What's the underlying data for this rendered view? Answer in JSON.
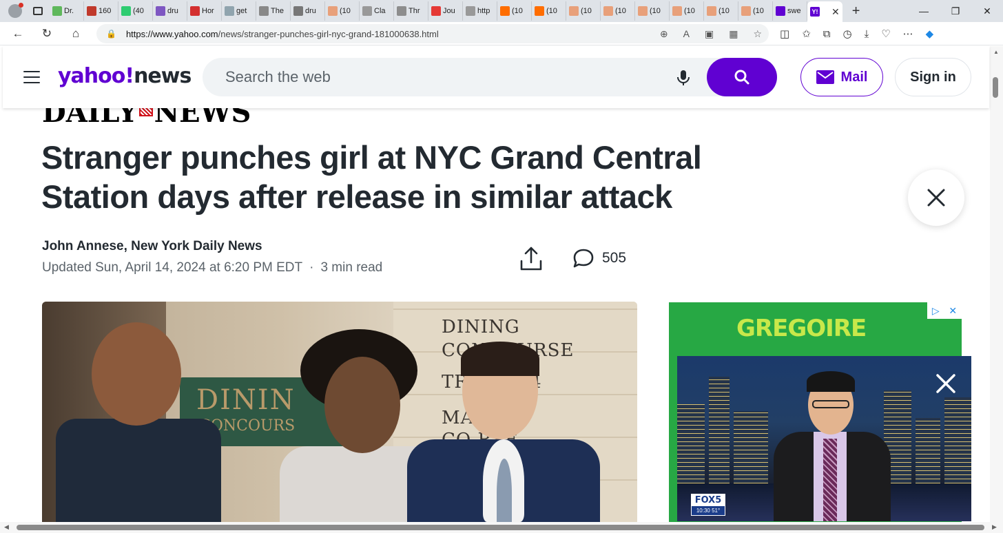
{
  "browser": {
    "tabs": [
      {
        "label": "Dr.",
        "color": "#5fb85c"
      },
      {
        "label": "160",
        "color": "#c0392b"
      },
      {
        "label": "(40",
        "color": "#2ecc71"
      },
      {
        "label": "dru",
        "color": "#7e57c2"
      },
      {
        "label": "Hor",
        "color": "#d32f2f"
      },
      {
        "label": "get",
        "color": "#90a4ae"
      },
      {
        "label": "The",
        "color": "#888888"
      },
      {
        "label": "dru",
        "color": "#777777"
      },
      {
        "label": "(10",
        "color": "#e8a07a"
      },
      {
        "label": "Cla",
        "color": "#999999"
      },
      {
        "label": "Thr",
        "color": "#8d8d8d"
      },
      {
        "label": "Jou",
        "color": "#e53935"
      },
      {
        "label": "http",
        "color": "#999999"
      },
      {
        "label": "(10",
        "color": "#ff6d00"
      },
      {
        "label": "(10",
        "color": "#ff6d00"
      },
      {
        "label": "(10",
        "color": "#e8a07a"
      },
      {
        "label": "(10",
        "color": "#e8a07a"
      },
      {
        "label": "(10",
        "color": "#e8a07a"
      },
      {
        "label": "(10",
        "color": "#e8a07a"
      },
      {
        "label": "(10",
        "color": "#e8a07a"
      },
      {
        "label": "(10",
        "color": "#e8a07a"
      },
      {
        "label": "swe",
        "color": "#6001d2"
      }
    ],
    "active_tab": {
      "label": "",
      "color": "#6001d2"
    },
    "url_host": "https://www.yahoo.com",
    "url_path": "/news/stranger-punches-girl-nyc-grand-181000638.html"
  },
  "header": {
    "logo_yahoo": "yahoo!",
    "logo_news": "news",
    "search_placeholder": "Search the web",
    "mail_label": "Mail",
    "signin_label": "Sign in",
    "brand_color": "#6001d2"
  },
  "article": {
    "publisher_left": "DAILY",
    "publisher_right": "NEWS",
    "headline": "Stranger punches girl at NYC Grand Central Station days after release in similar attack",
    "author": "John Annese, New York Daily News",
    "updated": "Updated Sun, April 14, 2024 at 6:20 PM EDT",
    "read_time": "3 min read",
    "comment_count": "505"
  },
  "hero": {
    "sign_main": "DININ",
    "sign_sub": "CONCOURS",
    "wall_lines": [
      "DINING",
      "CONCOURSE",
      "TR      02-114",
      "MA",
      "CO        RSE"
    ]
  },
  "ad": {
    "brand": "GREGOIRE"
  },
  "video": {
    "channel": "FOX5",
    "ticker": "10:30   51°"
  }
}
